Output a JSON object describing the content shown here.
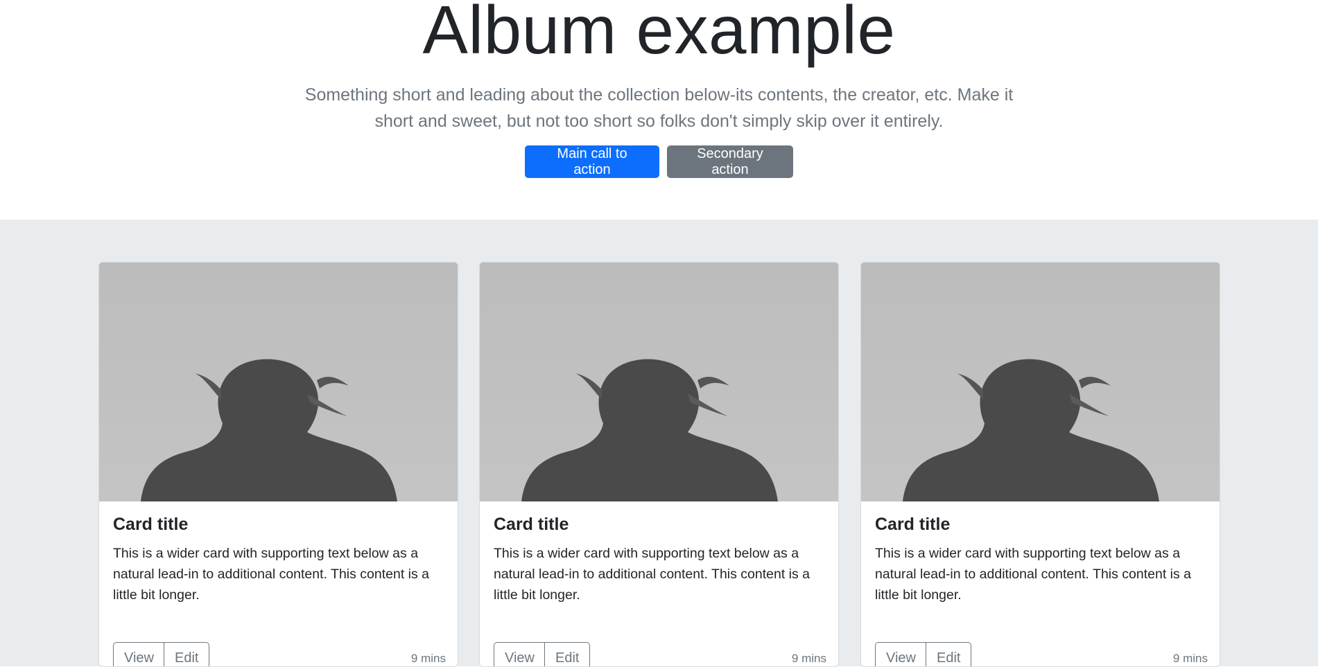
{
  "hero": {
    "title": "Album example",
    "lead": "Something short and leading about the collection below-its contents, the creator, etc. Make it short and sweet, but not too short so folks don't simply skip over it entirely.",
    "primary_button": "Main call to action",
    "secondary_button": "Secondary action"
  },
  "colors": {
    "primary": "#0d6efd",
    "secondary": "#6c757d",
    "album_bg": "#e9ecef"
  },
  "cards": [
    {
      "image": "woman-back-photo",
      "title": "Card title",
      "text": "This is a wider card with supporting text below as a natural lead-in to additional content. This content is a little bit longer.",
      "view_label": "View",
      "edit_label": "Edit",
      "meta": "9 mins"
    },
    {
      "image": "woman-back-photo",
      "title": "Card title",
      "text": "This is a wider card with supporting text below as a natural lead-in to additional content. This content is a little bit longer.",
      "view_label": "View",
      "edit_label": "Edit",
      "meta": "9 mins"
    },
    {
      "image": "woman-back-photo",
      "title": "Card title",
      "text": "This is a wider card with supporting text below as a natural lead-in to additional content. This content is a little bit longer.",
      "view_label": "View",
      "edit_label": "Edit",
      "meta": "9 mins"
    }
  ]
}
